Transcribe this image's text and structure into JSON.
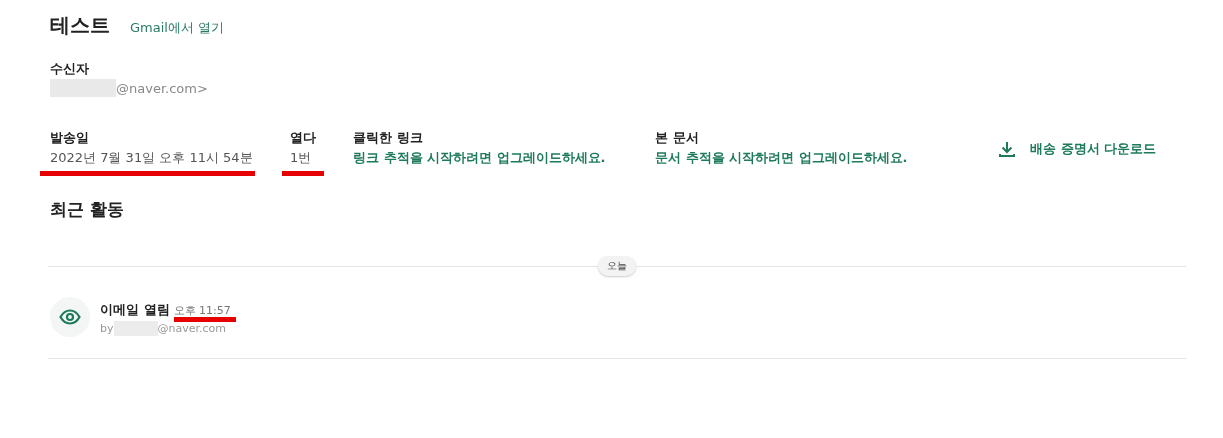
{
  "header": {
    "title": "테스트",
    "link": "Gmail에서 열기"
  },
  "recipient": {
    "label": "수신자",
    "redacted": true,
    "email_suffix": "@naver.com>"
  },
  "stats": [
    {
      "kind": "plain",
      "label": "발송일",
      "value": "2022년 7월 31일 오후 11시 54분",
      "highlighted": true
    },
    {
      "kind": "plain",
      "label": "열다",
      "value": "1번",
      "highlighted": true
    },
    {
      "kind": "link",
      "label": "클릭한 링크",
      "value": "링크 추적을 시작하려면 업그레이드하세요.",
      "highlighted": false
    },
    {
      "kind": "link",
      "label": "본 문서",
      "value": "문서 추적을 시작하려면 업그레이드하세요.",
      "highlighted": false
    }
  ],
  "download_button": {
    "label": "배송 증명서 다운로드"
  },
  "activity": {
    "title": "최근 활동",
    "date_pill": "오늘",
    "items": [
      {
        "kind": "opened",
        "title": "이메일 열림",
        "time": "오후 11:57",
        "time_highlighted": true,
        "by": "by",
        "redacted": true,
        "email_suffix": "@naver.com"
      }
    ]
  }
}
